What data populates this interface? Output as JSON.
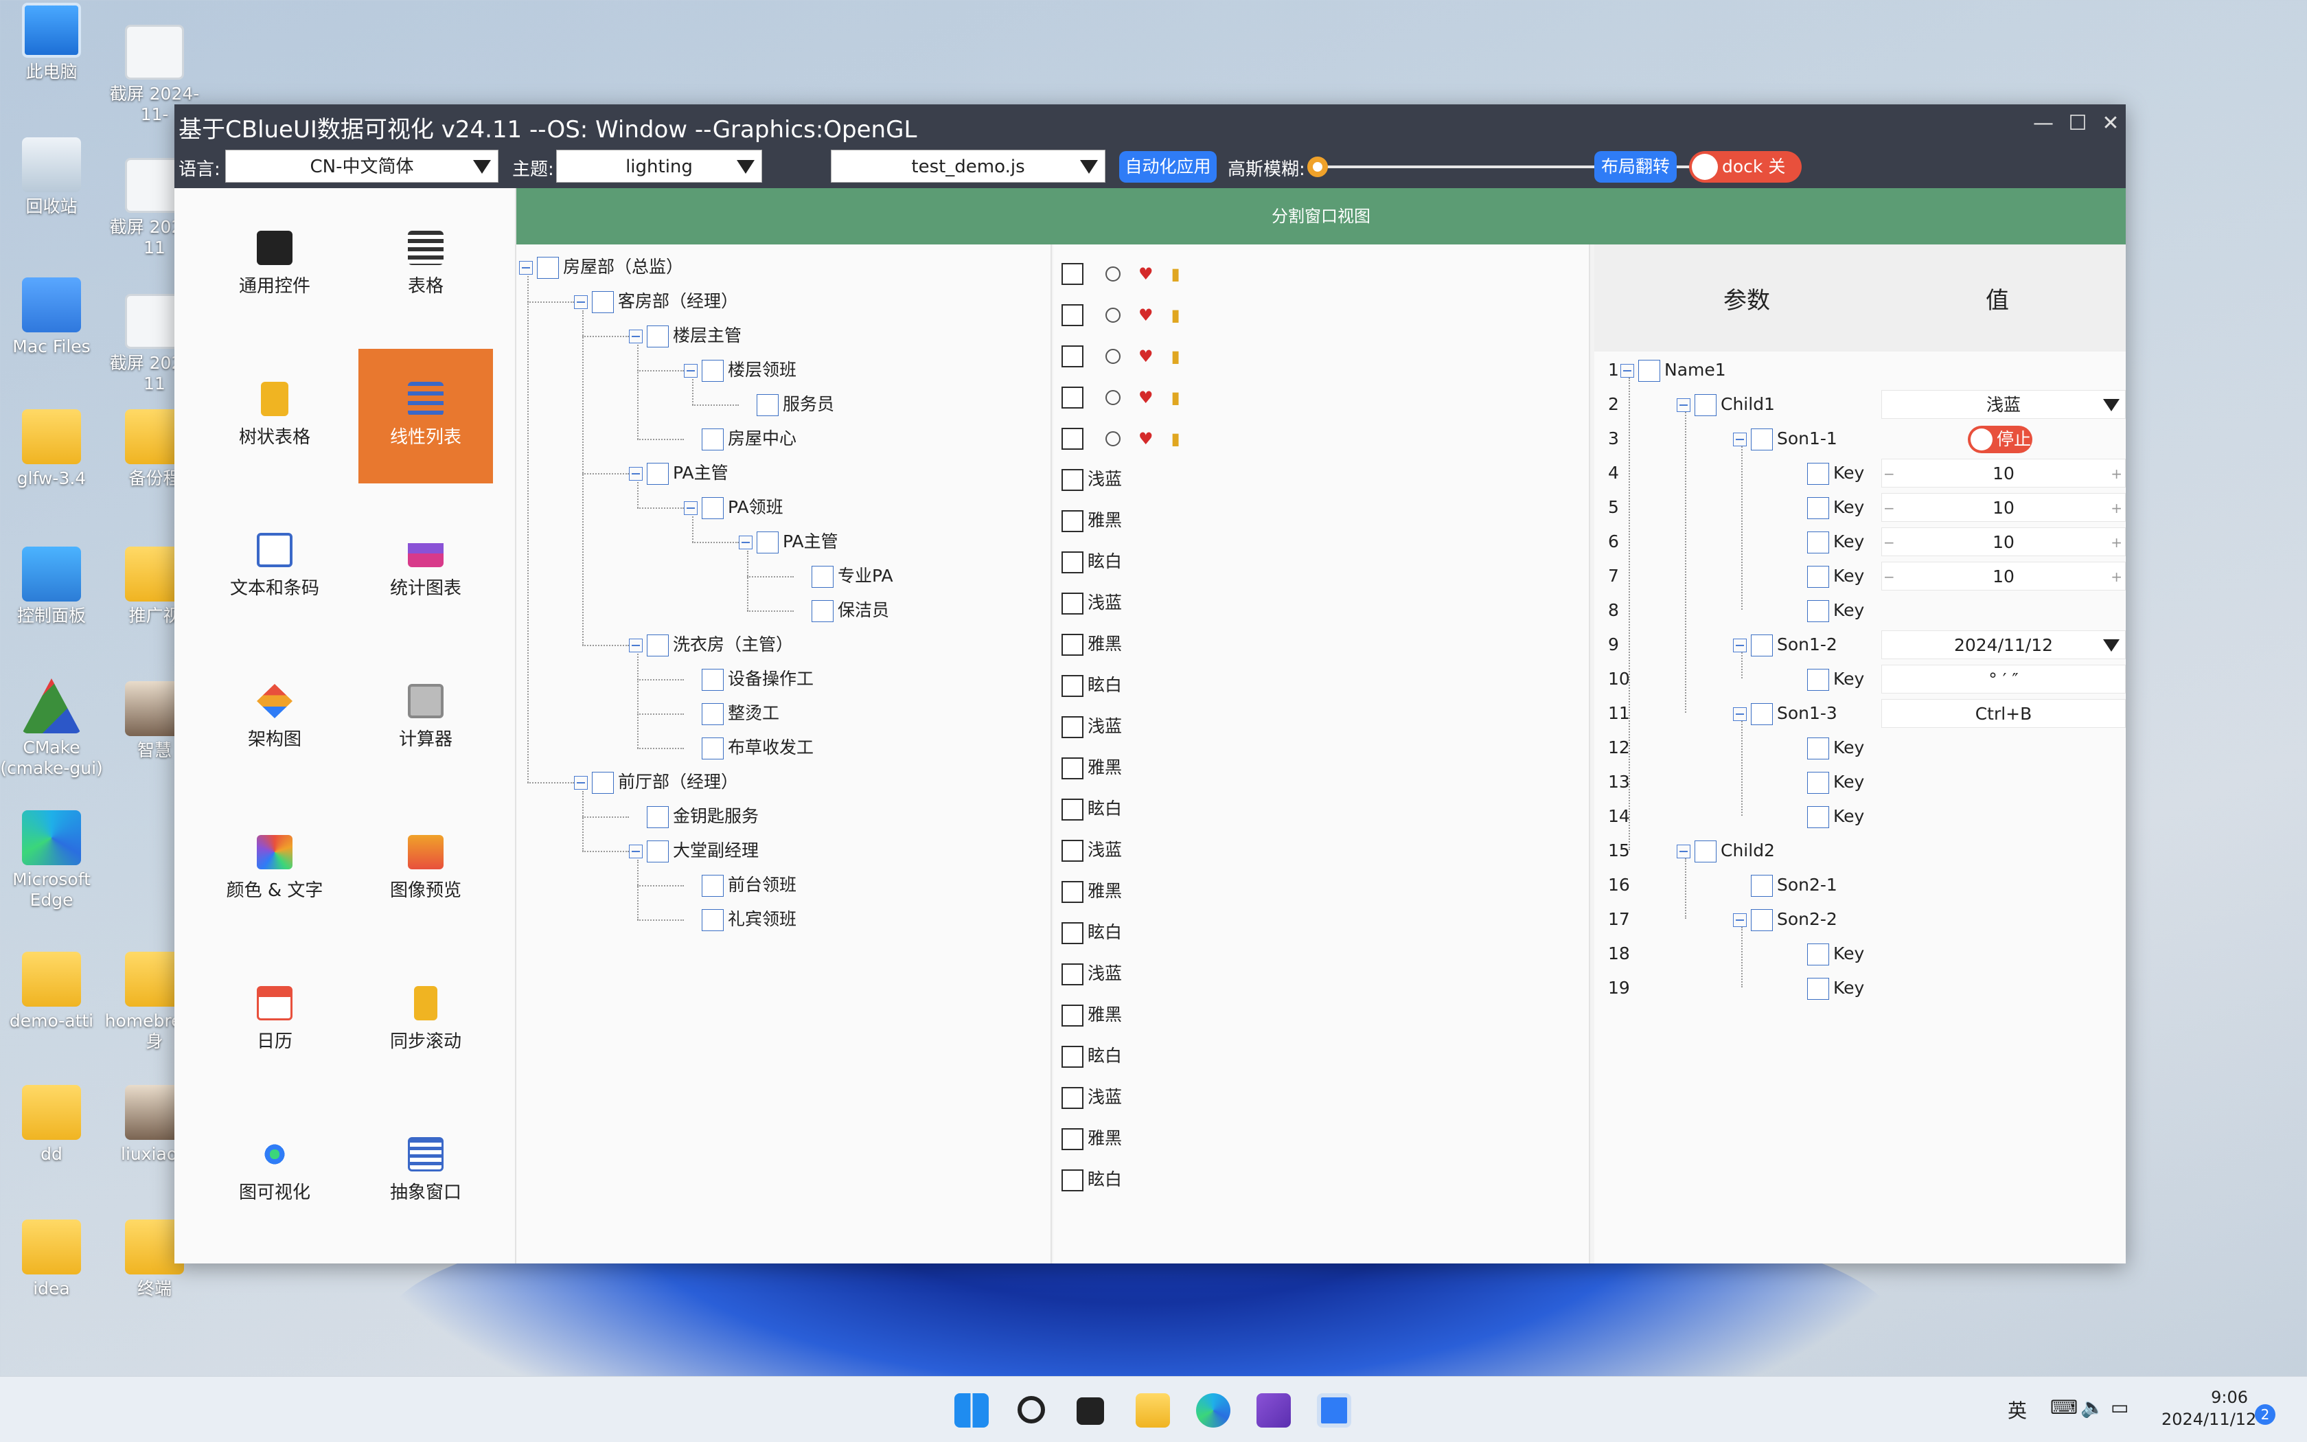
{
  "desktop": {
    "icons": [
      {
        "label": "此电脑"
      },
      {
        "label": "回收站"
      },
      {
        "label": "Mac Files"
      },
      {
        "label": "glfw-3.4"
      },
      {
        "label": "控制面板"
      },
      {
        "label": "CMake (cmake-gui)"
      },
      {
        "label": "Microsoft Edge"
      },
      {
        "label": "demo-atti"
      },
      {
        "label": "dd"
      },
      {
        "label": "idea"
      },
      {
        "label": "截屏 2024-11-"
      },
      {
        "label": "截屏 2024-11"
      },
      {
        "label": "截屏 2024-11"
      },
      {
        "label": "备份程"
      },
      {
        "label": "推广视"
      },
      {
        "label": "智慧"
      },
      {
        "label": "homebre 替身"
      },
      {
        "label": "liuxiaod"
      },
      {
        "label": "终端"
      }
    ]
  },
  "window": {
    "title": "基于CBlueUI数据可视化  v24.11  --OS: Window  --Graphics:OpenGL",
    "controls": {
      "minimize": "—",
      "maximize": "☐",
      "close": "✕"
    }
  },
  "toolbar": {
    "language_label": "语言:",
    "language_value": "CN-中文简体",
    "theme_label": "主题:",
    "theme_value": "lighting",
    "script_value": "test_demo.js",
    "auto_apply": "自动化应用",
    "blur_label": "高斯模糊:",
    "blur_value": 0,
    "layout_flip": "布局翻转",
    "dock_label": "dock 关闭"
  },
  "nav": {
    "items": [
      {
        "label": "通用控件",
        "icon": "code-icon"
      },
      {
        "label": "表格",
        "icon": "table-icon"
      },
      {
        "label": "树状表格",
        "icon": "tree-table-icon"
      },
      {
        "label": "线性列表",
        "icon": "list-icon",
        "active": true
      },
      {
        "label": "文本和条码",
        "icon": "text-icon"
      },
      {
        "label": "统计图表",
        "icon": "chart-icon"
      },
      {
        "label": "架构图",
        "icon": "architecture-icon"
      },
      {
        "label": "计算器",
        "icon": "calculator-icon"
      },
      {
        "label": "颜色 & 文字",
        "icon": "color-icon"
      },
      {
        "label": "图像预览",
        "icon": "image-icon"
      },
      {
        "label": "日历",
        "icon": "calendar-icon"
      },
      {
        "label": "同步滚动",
        "icon": "sync-scroll-icon"
      },
      {
        "label": "图可视化",
        "icon": "graph-icon"
      },
      {
        "label": "抽象窗口",
        "icon": "abstract-window-icon"
      }
    ]
  },
  "content": {
    "header": "分割窗口视图",
    "tree": [
      {
        "label": "房屋部（总监）",
        "level": 0,
        "expander": true
      },
      {
        "label": "客房部（经理）",
        "level": 1,
        "expander": true
      },
      {
        "label": "楼层主管",
        "level": 2,
        "expander": true
      },
      {
        "label": "楼层领班",
        "level": 3,
        "expander": true
      },
      {
        "label": "服务员",
        "level": 4,
        "expander": false
      },
      {
        "label": "房屋中心",
        "level": 3,
        "expander": false
      },
      {
        "label": "PA主管",
        "level": 2,
        "expander": true
      },
      {
        "label": "PA领班",
        "level": 3,
        "expander": true
      },
      {
        "label": "PA主管",
        "level": 4,
        "expander": true
      },
      {
        "label": "专业PA",
        "level": 5,
        "expander": false
      },
      {
        "label": "保洁员",
        "level": 5,
        "expander": false
      },
      {
        "label": "洗衣房（主管）",
        "level": 2,
        "expander": true
      },
      {
        "label": "设备操作工",
        "level": 3,
        "expander": false
      },
      {
        "label": "整烫工",
        "level": 3,
        "expander": false
      },
      {
        "label": "布草收发工",
        "level": 3,
        "expander": false
      },
      {
        "label": "前厅部（经理）",
        "level": 1,
        "expander": true
      },
      {
        "label": "金钥匙服务",
        "level": 2,
        "expander": false
      },
      {
        "label": "大堂副经理",
        "level": 2,
        "expander": true
      },
      {
        "label": "前台领班",
        "level": 3,
        "expander": false
      },
      {
        "label": "礼宾领班",
        "level": 3,
        "expander": false
      }
    ],
    "linear_list": {
      "icon_rows": 5,
      "labels": [
        "浅蓝",
        "雅黑",
        "眩白",
        "浅蓝",
        "雅黑",
        "眩白",
        "浅蓝",
        "雅黑",
        "眩白",
        "浅蓝",
        "雅黑",
        "眩白",
        "浅蓝",
        "雅黑",
        "眩白",
        "浅蓝",
        "雅黑",
        "眩白"
      ]
    },
    "params": {
      "header_param": "参数",
      "header_value": "值",
      "rows": [
        {
          "num": "1",
          "label": "Name1",
          "level": 0,
          "expander": true
        },
        {
          "num": "2",
          "label": "Child1",
          "level": 1,
          "expander": true,
          "value": "浅蓝",
          "type": "combo"
        },
        {
          "num": "3",
          "label": "Son1-1",
          "level": 2,
          "expander": true,
          "value": "停止",
          "type": "toggle"
        },
        {
          "num": "4",
          "label": "Key",
          "level": 3,
          "value": "10",
          "type": "spin"
        },
        {
          "num": "5",
          "label": "Key",
          "level": 3,
          "value": "10",
          "type": "spin"
        },
        {
          "num": "6",
          "label": "Key",
          "level": 3,
          "value": "10",
          "type": "spin"
        },
        {
          "num": "7",
          "label": "Key",
          "level": 3,
          "value": "10",
          "type": "spin"
        },
        {
          "num": "8",
          "label": "Key",
          "level": 3
        },
        {
          "num": "9",
          "label": "Son1-2",
          "level": 2,
          "expander": true,
          "value": "2024/11/12",
          "type": "combo"
        },
        {
          "num": "10",
          "label": "Key",
          "level": 3,
          "value": "°   ′   ″",
          "type": "text"
        },
        {
          "num": "11",
          "label": "Son1-3",
          "level": 2,
          "expander": true,
          "value": "Ctrl+B",
          "type": "text"
        },
        {
          "num": "12",
          "label": "Key",
          "level": 3
        },
        {
          "num": "13",
          "label": "Key",
          "level": 3
        },
        {
          "num": "14",
          "label": "Key",
          "level": 3
        },
        {
          "num": "15",
          "label": "Child2",
          "level": 1,
          "expander": true
        },
        {
          "num": "16",
          "label": "Son2-1",
          "level": 2
        },
        {
          "num": "17",
          "label": "Son2-2",
          "level": 2,
          "expander": true
        },
        {
          "num": "18",
          "label": "Key",
          "level": 3
        },
        {
          "num": "19",
          "label": "Key",
          "level": 3
        }
      ]
    }
  },
  "taskbar": {
    "ime": "英",
    "time": "9:06",
    "date": "2024/11/12",
    "notifications": "2"
  }
}
